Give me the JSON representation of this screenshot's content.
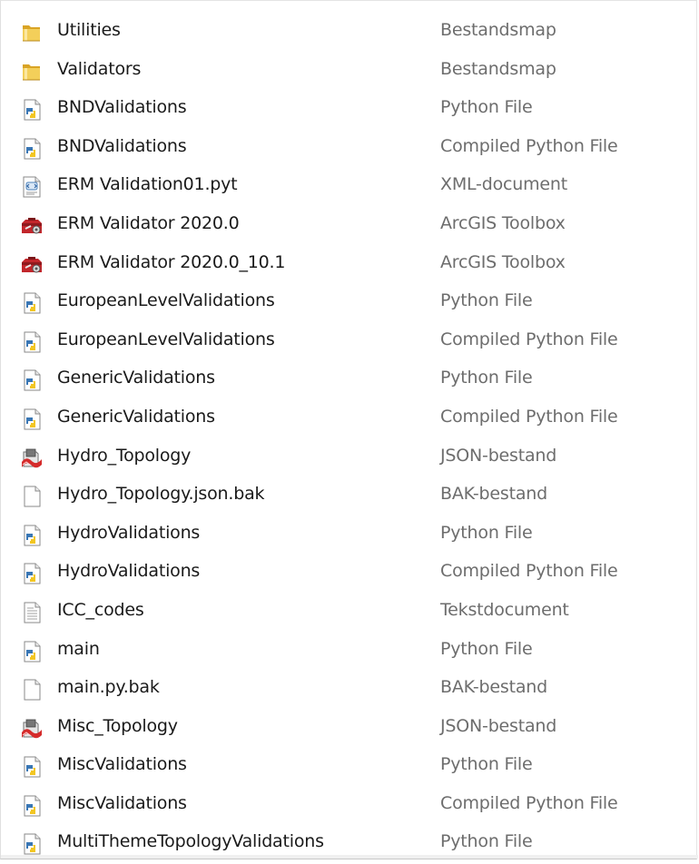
{
  "files": [
    {
      "name": "Utilities",
      "type": "Bestandsmap",
      "icon": "folder-icon"
    },
    {
      "name": "Validators",
      "type": "Bestandsmap",
      "icon": "folder-icon"
    },
    {
      "name": "BNDValidations",
      "type": "Python File",
      "icon": "python-file-icon"
    },
    {
      "name": "BNDValidations",
      "type": "Compiled Python File",
      "icon": "python-file-icon"
    },
    {
      "name": "ERM Validation01.pyt",
      "type": "XML-document",
      "icon": "xml-document-icon"
    },
    {
      "name": "ERM Validator 2020.0",
      "type": "ArcGIS Toolbox",
      "icon": "arcgis-toolbox-icon"
    },
    {
      "name": "ERM Validator 2020.0_10.1",
      "type": "ArcGIS Toolbox",
      "icon": "arcgis-toolbox-icon"
    },
    {
      "name": "EuropeanLevelValidations",
      "type": "Python File",
      "icon": "python-file-icon"
    },
    {
      "name": "EuropeanLevelValidations",
      "type": "Compiled Python File",
      "icon": "python-file-icon"
    },
    {
      "name": "GenericValidations",
      "type": "Python File",
      "icon": "python-file-icon"
    },
    {
      "name": "GenericValidations",
      "type": "Compiled Python File",
      "icon": "python-file-icon"
    },
    {
      "name": "Hydro_Topology",
      "type": "JSON-bestand",
      "icon": "json-file-icon"
    },
    {
      "name": "Hydro_Topology.json.bak",
      "type": "BAK-bestand",
      "icon": "blank-file-icon"
    },
    {
      "name": "HydroValidations",
      "type": "Python File",
      "icon": "python-file-icon"
    },
    {
      "name": "HydroValidations",
      "type": "Compiled Python File",
      "icon": "python-file-icon"
    },
    {
      "name": "ICC_codes",
      "type": "Tekstdocument",
      "icon": "text-document-icon"
    },
    {
      "name": "main",
      "type": "Python File",
      "icon": "python-file-icon"
    },
    {
      "name": "main.py.bak",
      "type": "BAK-bestand",
      "icon": "blank-file-icon"
    },
    {
      "name": "Misc_Topology",
      "type": "JSON-bestand",
      "icon": "json-file-icon"
    },
    {
      "name": "MiscValidations",
      "type": "Python File",
      "icon": "python-file-icon"
    },
    {
      "name": "MiscValidations",
      "type": "Compiled Python File",
      "icon": "python-file-icon"
    },
    {
      "name": "MultiThemeTopologyValidations",
      "type": "Python File",
      "icon": "python-file-icon"
    }
  ]
}
